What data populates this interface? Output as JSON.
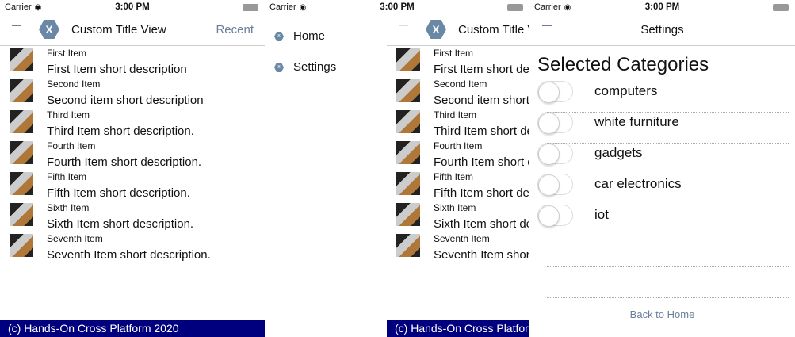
{
  "status": {
    "carrier": "Carrier",
    "time": "3:00 PM"
  },
  "main": {
    "title": "Custom Title View",
    "logo_letter": "X",
    "recent_label": "Recent",
    "items": [
      {
        "title": "First Item",
        "description": "First Item short description"
      },
      {
        "title": "Second Item",
        "description": "Second item short description"
      },
      {
        "title": "Third Item",
        "description": "Third Item short description."
      },
      {
        "title": "Fourth Item",
        "description": "Fourth Item short description."
      },
      {
        "title": "Fifth Item",
        "description": "Fifth Item short description."
      },
      {
        "title": "Sixth Item",
        "description": "Sixth Item short description."
      },
      {
        "title": "Seventh Item",
        "description": "Seventh Item short description."
      }
    ],
    "footer": "(c) Hands-On Cross Platform 2020"
  },
  "drawer": {
    "items": [
      {
        "label": "Home"
      },
      {
        "label": "Settings"
      }
    ]
  },
  "settings": {
    "title": "Settings",
    "heading": "Selected Categories",
    "categories": [
      {
        "label": "computers",
        "on": false
      },
      {
        "label": "white furniture",
        "on": false
      },
      {
        "label": "gadgets",
        "on": false
      },
      {
        "label": "car electronics",
        "on": false
      },
      {
        "label": "iot",
        "on": false
      }
    ],
    "back_label": "Back to Home"
  },
  "colors": {
    "accent": "#6a7f99",
    "footer": "#00007f",
    "logo": "#6a87a6"
  }
}
